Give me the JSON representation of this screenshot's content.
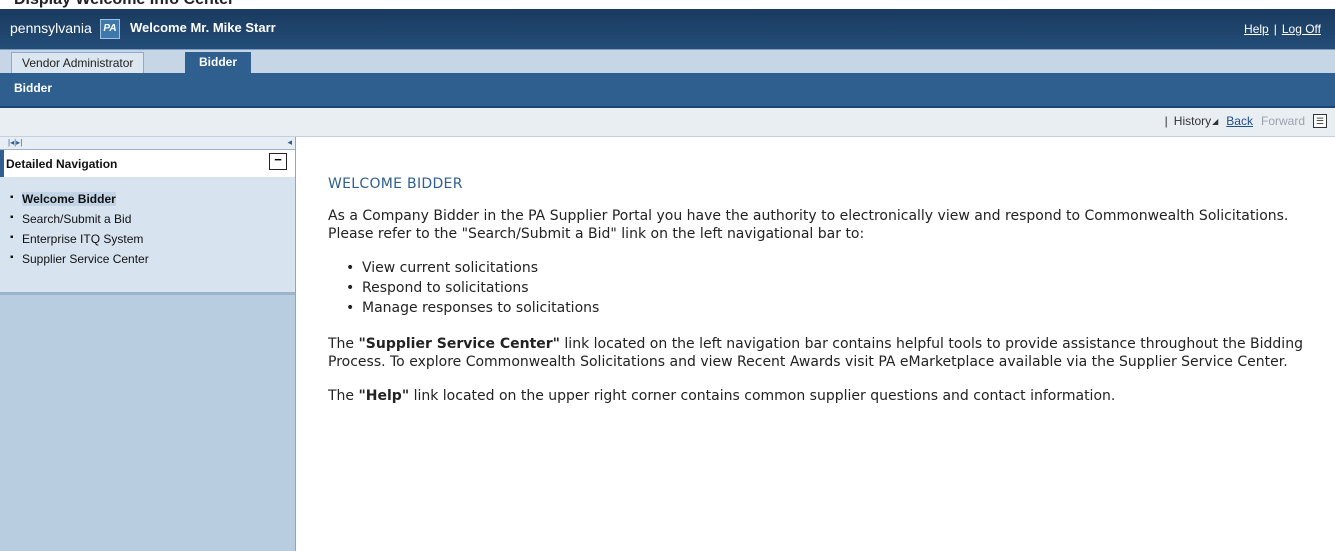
{
  "page_heading_clipped": "Display Welcome Info Center",
  "header": {
    "brand": "pennsylvania",
    "logo_text": "PA",
    "welcome": "Welcome Mr. Mike Starr",
    "help_link": "Help",
    "separator": "|",
    "logoff_link": "Log Off"
  },
  "tabs": {
    "vendor_admin": "Vendor Administrator",
    "bidder": "Bidder"
  },
  "subnav": {
    "title": "Bidder"
  },
  "history_bar": {
    "separator": "|",
    "history": "History",
    "history_arrow": "◢",
    "back": "Back",
    "forward": "Forward",
    "menu_icon": "☰"
  },
  "nav": {
    "top_controls": "|◂|▸|",
    "collapse_glyph": "◂",
    "title": "Detailed Navigation",
    "minimize_glyph": "−",
    "items": [
      {
        "label": "Welcome Bidder"
      },
      {
        "label": "Search/Submit a Bid"
      },
      {
        "label": "Enterprise ITQ System"
      },
      {
        "label": "Supplier Service Center"
      }
    ]
  },
  "content": {
    "heading": "WELCOME BIDDER",
    "intro": "As a Company Bidder in the PA Supplier Portal you have the authority to electronically view and respond to Commonwealth Solicitations.  Please refer to the \"Search/Submit a Bid\" link on the left navigational bar to:",
    "bullets": [
      "View current solicitations",
      "Respond to solicitations",
      "Manage responses to solicitations"
    ],
    "para2_pre": "The ",
    "para2_bold": "\"Supplier Service Center\"",
    "para2_post": " link located on the left navigation bar contains helpful tools to provide assistance throughout the Bidding Process.  To explore Commonwealth Solicitations and view Recent Awards visit PA eMarketplace available via the Supplier Service Center.",
    "para3_pre": "The ",
    "para3_bold": "\"Help\"",
    "para3_post": " link located on the upper right corner contains common supplier questions and contact information."
  }
}
